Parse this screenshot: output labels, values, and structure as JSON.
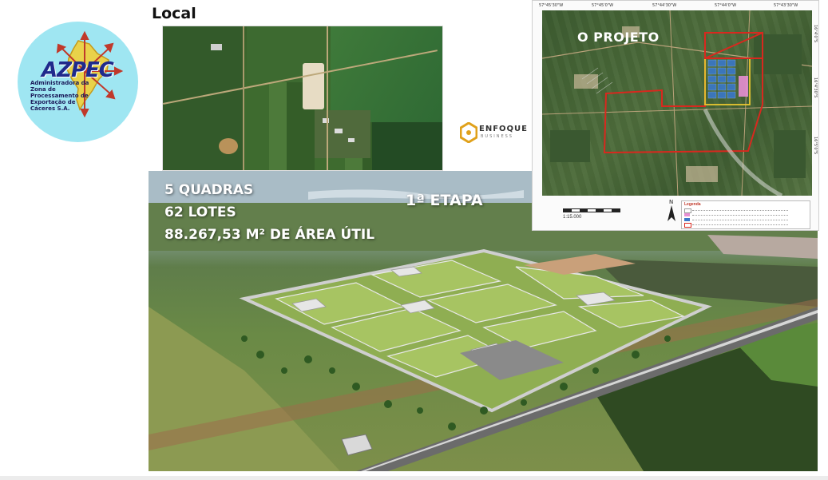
{
  "logo": {
    "wordmark": "AZPEC",
    "caption": "Administradora da Zona de Processamento de Exportação de Cáceres S.A."
  },
  "local": {
    "title": "Local"
  },
  "project_map": {
    "title": "O PROJETO",
    "scale": "1:15.000",
    "legend_title": "Legenda",
    "top_coords": [
      "57°45'30\"W",
      "57°45'0\"W",
      "57°44'30\"W",
      "57°44'0\"W",
      "57°43'30\"W"
    ],
    "side_coords": [
      "16°4'0\"S",
      "16°4'30\"S",
      "16°5'0\"S"
    ],
    "colors": {
      "boundary_red": "#d9281e",
      "phase_yellow": "#e8c630",
      "lots_blue": "#3a78c9",
      "area_pink": "#e78fd3"
    }
  },
  "aerial": {
    "line1": "5 QUADRAS",
    "line2": "62 LOTES",
    "line3": "88.267,53 M² DE ÁREA ÚTIL",
    "phase": "1ª ETAPA"
  },
  "enfoque": {
    "name": "ENFOQUE",
    "sub": "BUSINESS"
  }
}
